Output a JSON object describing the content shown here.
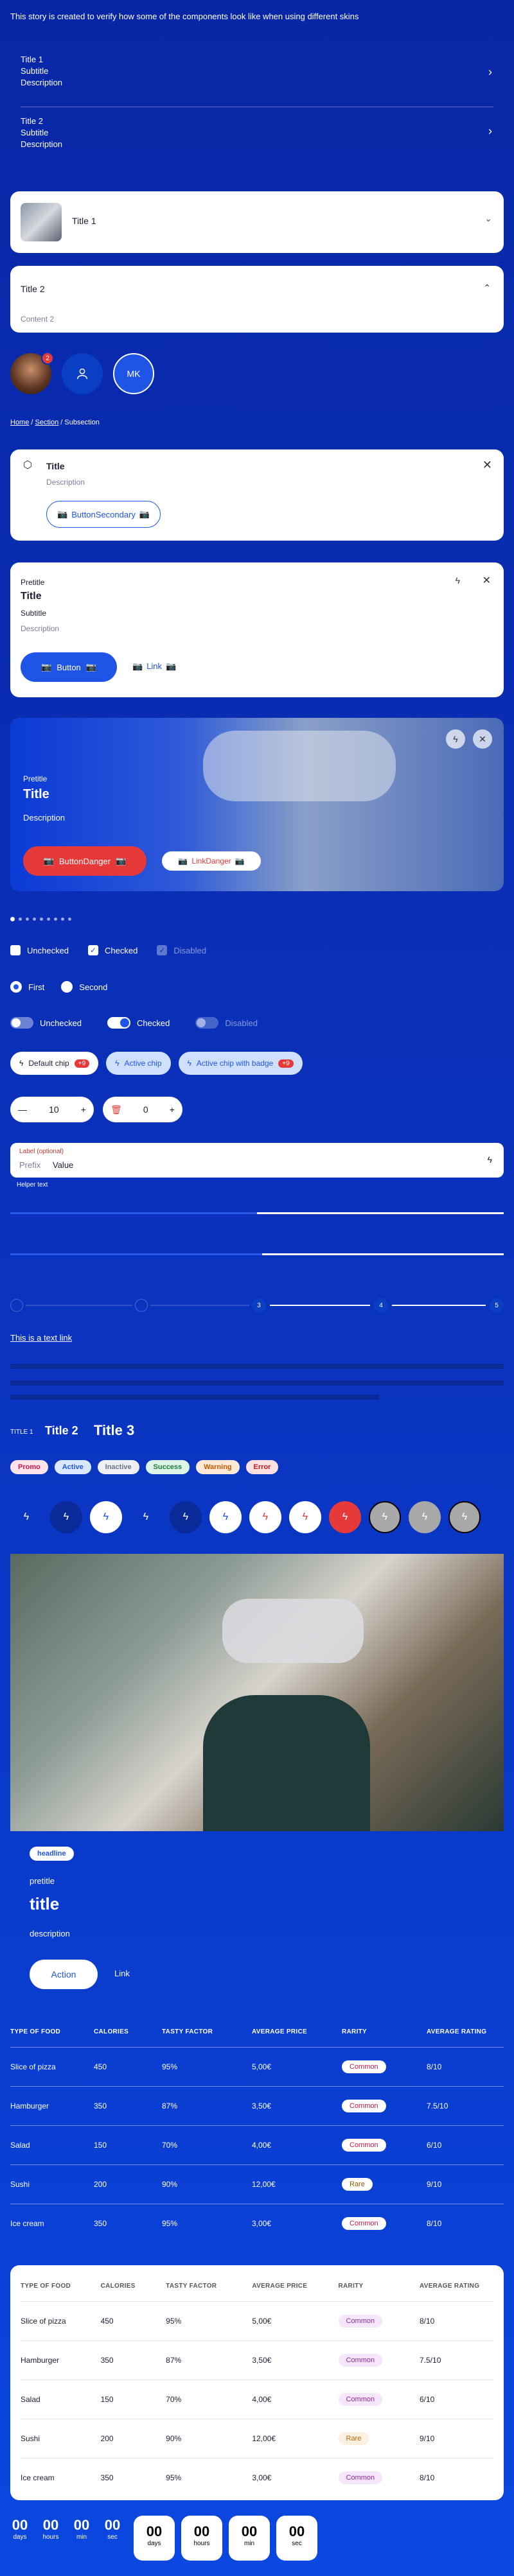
{
  "intro": "This story is created to verify how some of the components look like when using different skins",
  "list": [
    {
      "title": "Title 1",
      "subtitle": "Subtitle",
      "description": "Description"
    },
    {
      "title": "Title 2",
      "subtitle": "Subtitle",
      "description": "Description"
    }
  ],
  "accordion1": {
    "title": "Title 1"
  },
  "accordion2": {
    "title": "Title 2",
    "content": "Content 2"
  },
  "avatars": {
    "initials": "MK",
    "badge": "2"
  },
  "breadcrumb": {
    "home": "Home",
    "sep": "/",
    "section": "Section",
    "sub": "Subsection"
  },
  "card1": {
    "title": "Title",
    "description": "Description",
    "button": "ButtonSecondary"
  },
  "card2": {
    "pretitle": "Pretitle",
    "title": "Title",
    "subtitle": "Subtitle",
    "description": "Description",
    "button": "Button",
    "link": "Link"
  },
  "card3": {
    "pretitle": "Pretitle",
    "title": "Title",
    "description": "Description",
    "button": "ButtonDanger",
    "link": "LinkDanger"
  },
  "checkboxes": {
    "a": "Unchecked",
    "b": "Checked",
    "c": "Disabled"
  },
  "radios": {
    "a": "First",
    "b": "Second"
  },
  "switches": {
    "a": "Unchecked",
    "b": "Checked",
    "c": "Disabled"
  },
  "chips": {
    "a": "Default chip",
    "a_badge": "+9",
    "b": "Active chip",
    "c": "Active chip with badge",
    "c_badge": "+9"
  },
  "steppers": {
    "a": "10",
    "b": "0"
  },
  "field": {
    "label": "Label (optional)",
    "prefix": "Prefix",
    "value": "Value",
    "helper": "Helper text"
  },
  "stepper_steps": [
    "3",
    "4",
    "5"
  ],
  "textlink": "This is a text link",
  "titles": {
    "t1": "TITLE 1",
    "t2": "Title 2",
    "t3": "Title 3"
  },
  "tags": [
    "Promo",
    "Active",
    "Inactive",
    "Success",
    "Warning",
    "Error"
  ],
  "hero": {
    "headline": "headline",
    "pretitle": "pretitle",
    "title": "title",
    "description": "description",
    "action": "Action",
    "link": "Link"
  },
  "table": {
    "headers": [
      "TYPE OF FOOD",
      "CALORIES",
      "TASTY FACTOR",
      "AVERAGE PRICE",
      "RARITY",
      "AVERAGE RATING"
    ],
    "rows": [
      [
        "Slice of pizza",
        "450",
        "95%",
        "5,00€",
        "Common",
        "8/10"
      ],
      [
        "Hamburger",
        "350",
        "87%",
        "3,50€",
        "Common",
        "7.5/10"
      ],
      [
        "Salad",
        "150",
        "70%",
        "4,00€",
        "Common",
        "6/10"
      ],
      [
        "Sushi",
        "200",
        "90%",
        "12,00€",
        "Rare",
        "9/10"
      ],
      [
        "Ice cream",
        "350",
        "95%",
        "3,00€",
        "Common",
        "8/10"
      ]
    ]
  },
  "countdown": {
    "values": [
      "00",
      "00",
      "00",
      "00"
    ],
    "labels": [
      "days",
      "hours",
      "min",
      "sec"
    ]
  },
  "colors": {
    "bg": "#0a30b8",
    "accent": "#1f55e6",
    "danger": "#e63939"
  }
}
